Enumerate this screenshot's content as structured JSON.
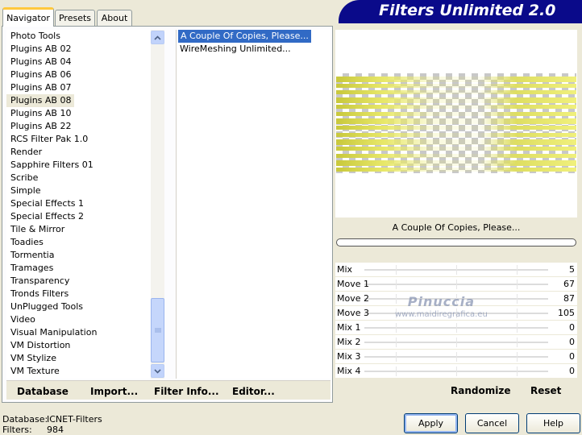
{
  "tabs": [
    {
      "label": "Navigator"
    },
    {
      "label": "Presets"
    },
    {
      "label": "About"
    }
  ],
  "logo_text": "Filters Unlimited 2.0",
  "categories": [
    "Photo Tools",
    "Plugins AB 02",
    "Plugins AB 04",
    "Plugins AB 06",
    "Plugins AB 07",
    "Plugins AB 08",
    "Plugins AB 10",
    "Plugins AB 22",
    "RCS Filter Pak 1.0",
    "Render",
    "Sapphire Filters 01",
    "Scribe",
    "Simple",
    "Special Effects 1",
    "Special Effects 2",
    "Tile & Mirror",
    "Toadies",
    "Tormentia",
    "Tramages",
    "Transparency",
    "Tronds Filters",
    "UnPlugged Tools",
    "Video",
    "Visual Manipulation",
    "VM Distortion",
    "VM Stylize",
    "VM Texture"
  ],
  "selected_category": "Plugins AB 08",
  "filters": [
    "A Couple Of Copies, Please...",
    "WireMeshing Unlimited..."
  ],
  "selected_filter": "A Couple Of Copies, Please...",
  "left_buttons": {
    "database": "Database",
    "import": "Import...",
    "filter_info": "Filter Info...",
    "editor": "Editor..."
  },
  "preview_filter_name": "A Couple Of Copies, Please...",
  "sliders": [
    {
      "label": "Mix",
      "value": "5"
    },
    {
      "label": "Move 1",
      "value": "67"
    },
    {
      "label": "Move 2",
      "value": "87"
    },
    {
      "label": "Move 3",
      "value": "105"
    },
    {
      "label": "Mix 1",
      "value": "0"
    },
    {
      "label": "Mix 2",
      "value": "0"
    },
    {
      "label": "Mix 3",
      "value": "0"
    },
    {
      "label": "Mix 4",
      "value": "0"
    }
  ],
  "watermark": {
    "name": "Pinuccia",
    "site": "www.maidiregrafica.eu"
  },
  "right_buttons": {
    "randomize": "Randomize",
    "reset": "Reset"
  },
  "status": {
    "database_label": "Database:",
    "database_value": "ICNET-Filters",
    "filters_label": "Filters:",
    "filters_value": "984"
  },
  "dialog_buttons": {
    "apply": "Apply",
    "cancel": "Cancel",
    "help": "Help"
  },
  "colors": {
    "selection": "#316ac5",
    "logo_bg": "#0a0a8a",
    "tab_highlight": "#ffc83c"
  }
}
